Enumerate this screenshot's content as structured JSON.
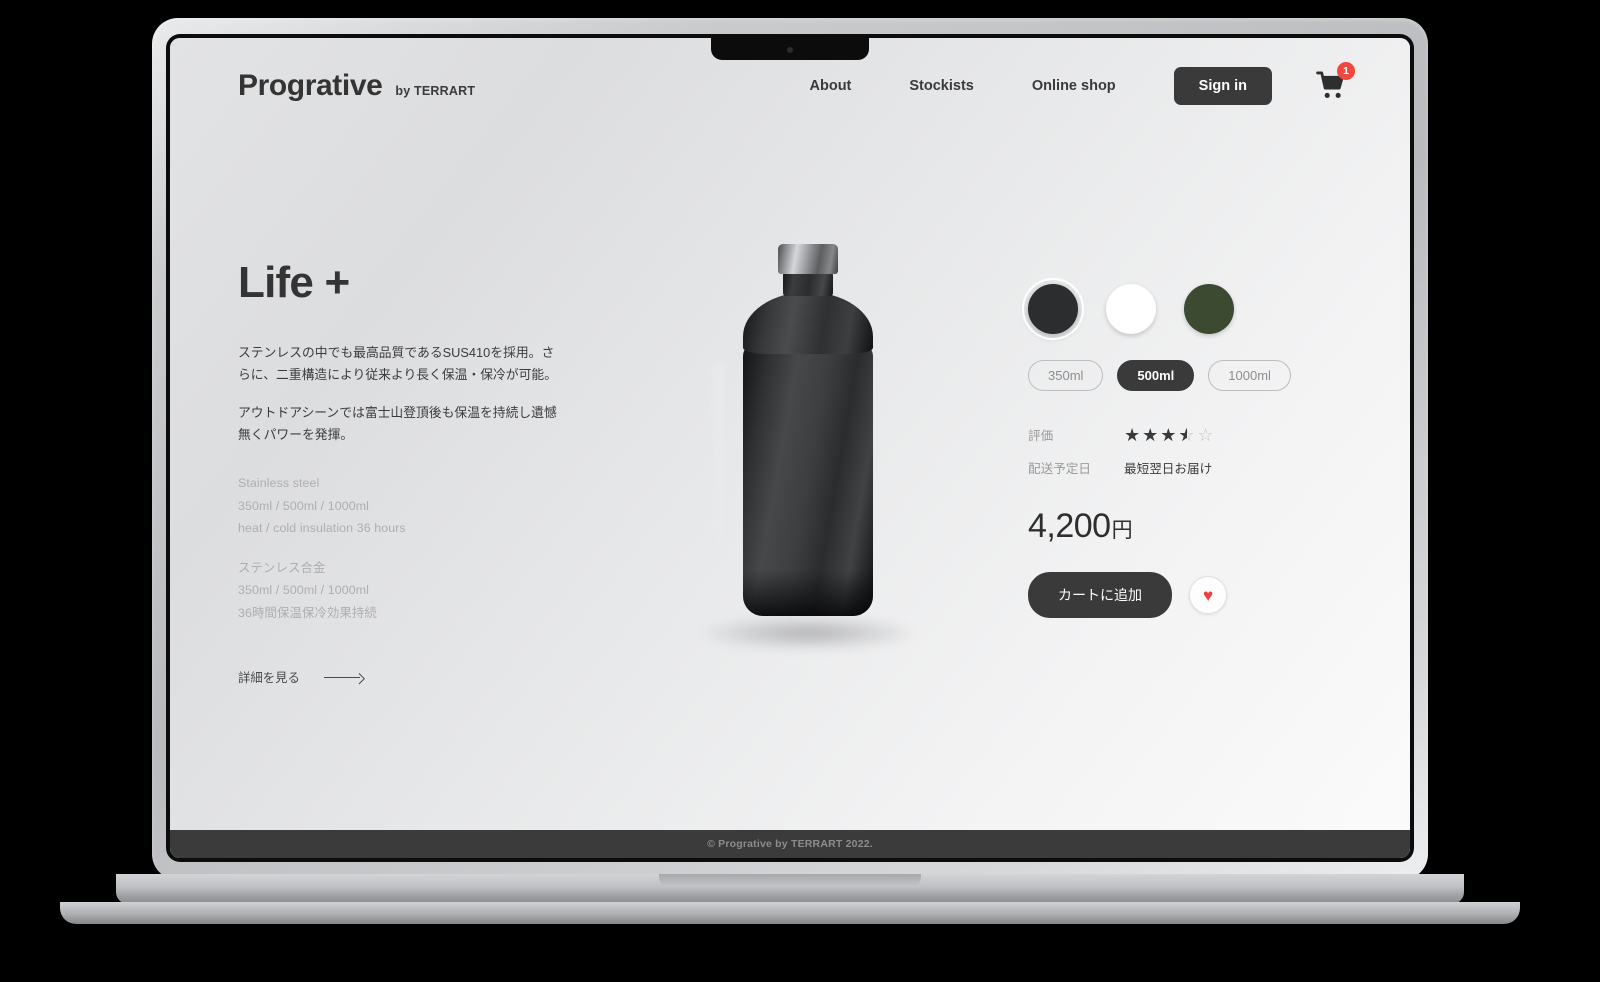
{
  "header": {
    "brand_name": "Progrative",
    "brand_sub": "by TERRART",
    "nav": [
      {
        "label": "About"
      },
      {
        "label": "Stockists"
      },
      {
        "label": "Online shop"
      }
    ],
    "signin_label": "Sign in",
    "cart_icon": "shopping-cart-icon",
    "cart_badge_count": "1"
  },
  "hero": {
    "title": "Life +",
    "paragraphs": [
      "ステンレスの中でも最高品質であるSUS410を採用。さらに、二重構造により従来より長く保温・保冷が可能。",
      "アウトドアシーンでは富士山登頂後も保温を持続し遺憾無くパワーを発揮。"
    ],
    "spec_en": [
      "Stainless steel",
      "350ml / 500ml / 1000ml",
      "heat / cold insulation 36 hours"
    ],
    "spec_jp": [
      "ステンレス合金",
      "350ml / 500ml / 1000ml",
      "36時間保温保冷効果持続"
    ],
    "detail_link_label": "詳細を見る",
    "detail_link_icon": "arrow-right-icon"
  },
  "product": {
    "image_name": "black-insulated-water-bottle"
  },
  "options": {
    "colors": [
      {
        "name": "black",
        "hex": "#2c2d2f",
        "selected": true
      },
      {
        "name": "white",
        "hex": "#ffffff",
        "selected": false
      },
      {
        "name": "olive-green",
        "hex": "#3c4a31",
        "selected": false
      }
    ],
    "sizes": [
      {
        "label": "350ml",
        "selected": false
      },
      {
        "label": "500ml",
        "selected": true
      },
      {
        "label": "1000ml",
        "selected": false
      }
    ],
    "rating_label": "評価",
    "rating_value": 3.5,
    "rating_max": 5,
    "delivery_label": "配送予定日",
    "delivery_value": "最短翌日お届け",
    "price_amount": "4,200",
    "price_currency": "円",
    "add_to_cart_label": "カートに追加",
    "favorite_icon": "heart-icon"
  },
  "footer": {
    "copyright": "© Progrative by TERRART 2022."
  },
  "colors": {
    "accent_dark": "#3a3a3a",
    "badge_red": "#f0483e",
    "heart_red": "#ef3f3f",
    "muted_text": "#aeaeae"
  }
}
